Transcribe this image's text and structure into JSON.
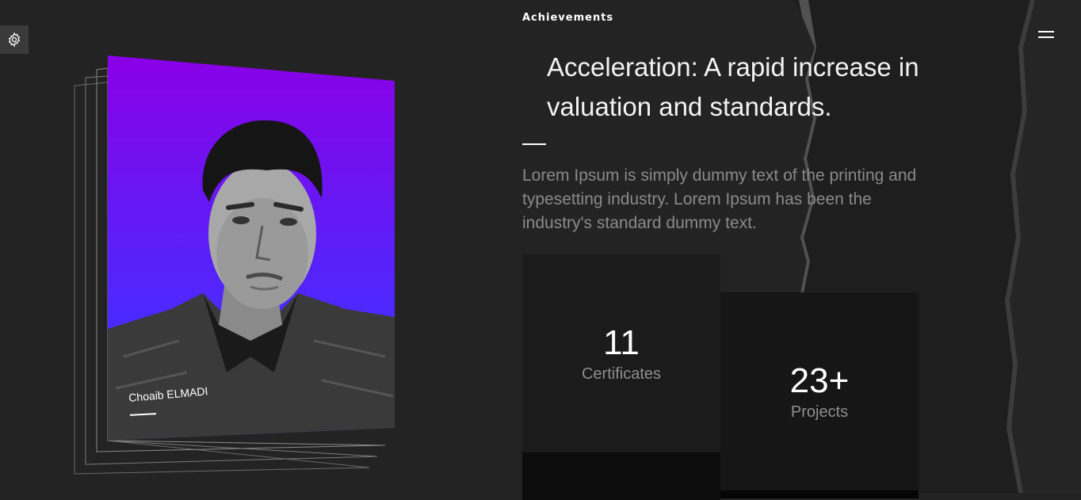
{
  "settings": {
    "icon": "gear-icon"
  },
  "menu": {
    "icon": "hamburger-menu-icon"
  },
  "portrait": {
    "caption": "Choaib ELMADI",
    "gradient_top": "#8a00e6",
    "gradient_bottom": "#4a2bff"
  },
  "achievements": {
    "section_label": "Achievements",
    "headline": "Acceleration: A rapid increase in valuation and standards.",
    "body": "Lorem Ipsum is simply dummy text of the printing and typesetting industry. Lorem Ipsum has been the industry's standard dummy text.",
    "stats": [
      {
        "value": "11",
        "label": "Certificates"
      },
      {
        "value": "23+",
        "label": "Projects"
      }
    ]
  }
}
